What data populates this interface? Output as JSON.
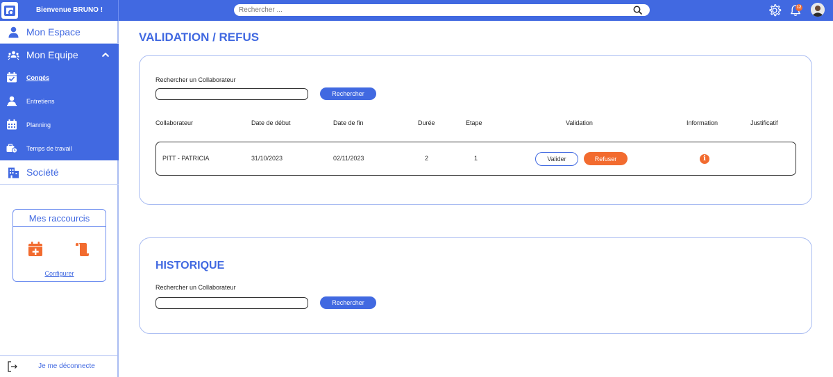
{
  "header": {
    "welcome": "Bienvenue BRUNO !",
    "search_placeholder": "Rechercher ...",
    "notification_count": "12"
  },
  "sidebar": {
    "items": [
      {
        "label": "Mon Espace",
        "icon": "user-icon"
      },
      {
        "label": "Mon Equipe",
        "icon": "team-icon",
        "expanded": true
      },
      {
        "label": "Société",
        "icon": "building-icon"
      }
    ],
    "subitems": [
      {
        "label": "Congés",
        "icon": "calendar-check-icon",
        "current": true
      },
      {
        "label": "Entretiens",
        "icon": "meeting-icon"
      },
      {
        "label": "Planning",
        "icon": "calendar-grid-icon"
      },
      {
        "label": "Temps de travail",
        "icon": "clock-briefcase-icon"
      }
    ],
    "shortcuts": {
      "title": "Mes raccourcis",
      "configure": "Configurer"
    },
    "logout": "Je me déconnecte"
  },
  "main": {
    "title": "VALIDATION / REFUS",
    "validation": {
      "search_label": "Rechercher un Collaborateur",
      "search_value": "",
      "search_button": "Rechercher",
      "columns": [
        "Collaborateur",
        "Date de début",
        "Date de fin",
        "Durée",
        "Etape",
        "Validation",
        "Information",
        "Justificatif"
      ],
      "rows": [
        {
          "collaborateur": "PITT - PATRICIA",
          "debut": "31/10/2023",
          "fin": "02/11/2023",
          "duree": "2",
          "etape": "1",
          "valider": "Valider",
          "refuser": "Refuser"
        }
      ]
    },
    "historique": {
      "title": "HISTORIQUE",
      "search_label": "Rechercher un Collaborateur",
      "search_value": "",
      "search_button": "Rechercher"
    }
  },
  "colors": {
    "primary": "#4169e1",
    "accent": "#f26b2f",
    "border": "#a9bcf2"
  }
}
